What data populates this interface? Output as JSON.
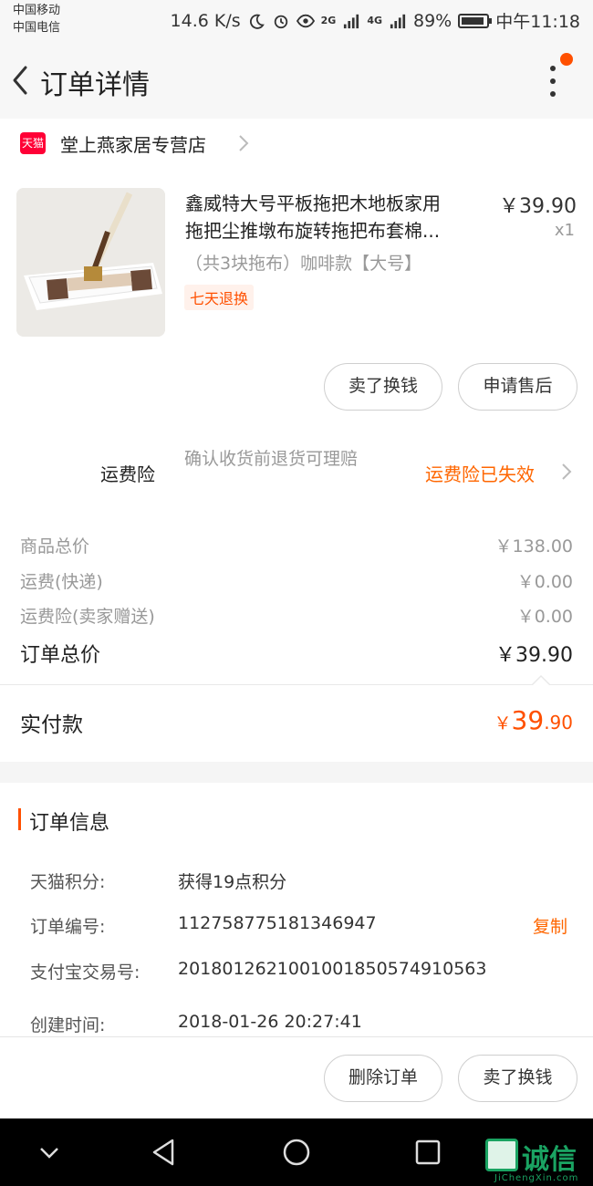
{
  "status_bar": {
    "carrier_1": "中国移动",
    "carrier_2": "中国电信",
    "net_speed": "14.6 K/s",
    "signal_1": "2G",
    "signal_2": "4G",
    "battery": "89%",
    "time": "中午11:18"
  },
  "header": {
    "title": "订单详情",
    "back_icon": "chevron-left-icon",
    "more_icon": "more-vertical-icon"
  },
  "shop": {
    "badge": "天猫",
    "name": "堂上燕家居专营店"
  },
  "product": {
    "title_line1": "鑫威特大号平板拖把木地板家用",
    "title_line2": "拖把尘推墩布旋转拖把布套棉...",
    "price": "￥39.90",
    "qty": "x1",
    "sku": "（共3块拖布）咖啡款【大号】",
    "tag": "七天退换"
  },
  "product_actions": {
    "sell_exchange": "卖了换钱",
    "after_sale": "申请售后"
  },
  "insurance": {
    "label": "运费险",
    "desc": "确认收货前退货可理赔",
    "status": "运费险已失效"
  },
  "totals": {
    "goods_label": "商品总价",
    "goods_value": "￥138.00",
    "shipping_label": "运费(快递)",
    "shipping_value": "￥0.00",
    "insurance_label": "运费险(卖家赠送)",
    "insurance_value": "￥0.00",
    "order_total_label": "订单总价",
    "order_total_value": "￥39.90"
  },
  "paid": {
    "label": "实付款",
    "currency": "￥",
    "integer": "39",
    "decimal": ".90"
  },
  "order_info": {
    "title": "订单信息",
    "points_label": "天猫积分:",
    "points_value": "获得19点积分",
    "order_no_label": "订单编号:",
    "order_no_value": "112758775181346947",
    "copy": "复制",
    "alipay_label": "支付宝交易号:",
    "alipay_value": "2018012621001001850574910563",
    "created_label": "创建时间:",
    "created_value": "2018-01-26 20:27:41"
  },
  "bottom_actions": {
    "delete": "删除订单",
    "sell_exchange": "卖了换钱"
  },
  "watermark": {
    "text": "诚信",
    "sub": "JiChengXin.com"
  },
  "colors": {
    "accent": "#ff5000",
    "orange_text": "#ff6600",
    "tmall_red": "#ff0036",
    "watermark_green": "#1aa362"
  }
}
